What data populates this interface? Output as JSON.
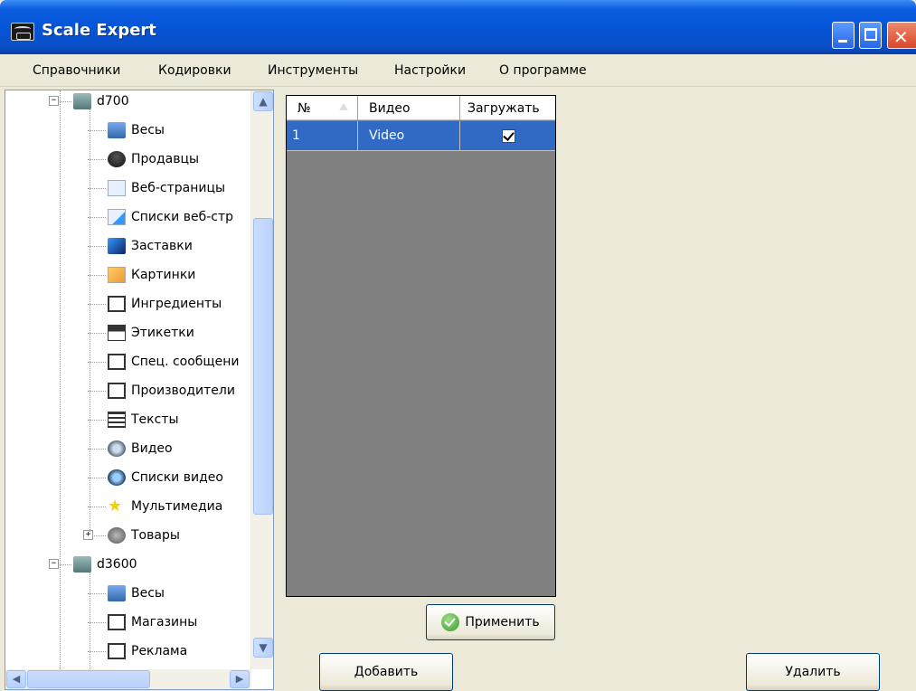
{
  "window": {
    "title": "Scale Expert",
    "minimize_icon": "minimize-icon",
    "maximize_icon": "maximize-icon",
    "close_icon": "close-icon"
  },
  "menu": {
    "items": [
      "Справочники",
      "Кодировки",
      "Инструменты",
      "Настройки",
      "О программе"
    ]
  },
  "tree": {
    "nodes": [
      {
        "label": "d700",
        "icon": "scale-device-icon",
        "level": 0,
        "expander": "−"
      },
      {
        "label": "Весы",
        "icon": "scales-icon",
        "level": 1
      },
      {
        "label": "Продавцы",
        "icon": "sellers-icon",
        "level": 1
      },
      {
        "label": "Веб-страницы",
        "icon": "web-page-icon",
        "level": 1
      },
      {
        "label": "Списки веб-стр",
        "icon": "web-list-icon",
        "level": 1
      },
      {
        "label": "Заставки",
        "icon": "screensaver-icon",
        "level": 1
      },
      {
        "label": "Картинки",
        "icon": "pictures-icon",
        "level": 1
      },
      {
        "label": "Ингредиенты",
        "icon": "ingredients-icon",
        "level": 1
      },
      {
        "label": "Этикетки",
        "icon": "labels-icon",
        "level": 1
      },
      {
        "label": "Спец. сообщени",
        "icon": "special-message-icon",
        "level": 1
      },
      {
        "label": "Производители",
        "icon": "manufacturers-icon",
        "level": 1
      },
      {
        "label": "Тексты",
        "icon": "texts-icon",
        "level": 1
      },
      {
        "label": "Видео",
        "icon": "video-icon",
        "level": 1
      },
      {
        "label": "Списки видео",
        "icon": "video-list-icon",
        "level": 1
      },
      {
        "label": "Мультимедиа",
        "icon": "star-icon",
        "level": 1
      },
      {
        "label": "Товары",
        "icon": "goods-icon",
        "level": 1,
        "expander": "+"
      },
      {
        "label": "d3600",
        "icon": "scale-device-icon",
        "level": 0,
        "expander": "−"
      },
      {
        "label": "Весы",
        "icon": "scales-icon",
        "level": 1
      },
      {
        "label": "Магазины",
        "icon": "stores-icon",
        "level": 1
      },
      {
        "label": "Реклама",
        "icon": "ads-icon",
        "level": 1
      }
    ]
  },
  "grid": {
    "columns": [
      "№",
      "Видео",
      "Загружать"
    ],
    "rows": [
      {
        "num": "1",
        "video": "Video",
        "load": true
      }
    ]
  },
  "buttons": {
    "apply": "Применить",
    "add": "Добавить",
    "delete": "Удалить"
  },
  "colors": {
    "title_blue": "#0654d6",
    "selected_row": "#316ac5",
    "grid_bg": "#808080",
    "window_bg": "#ece9d8"
  }
}
